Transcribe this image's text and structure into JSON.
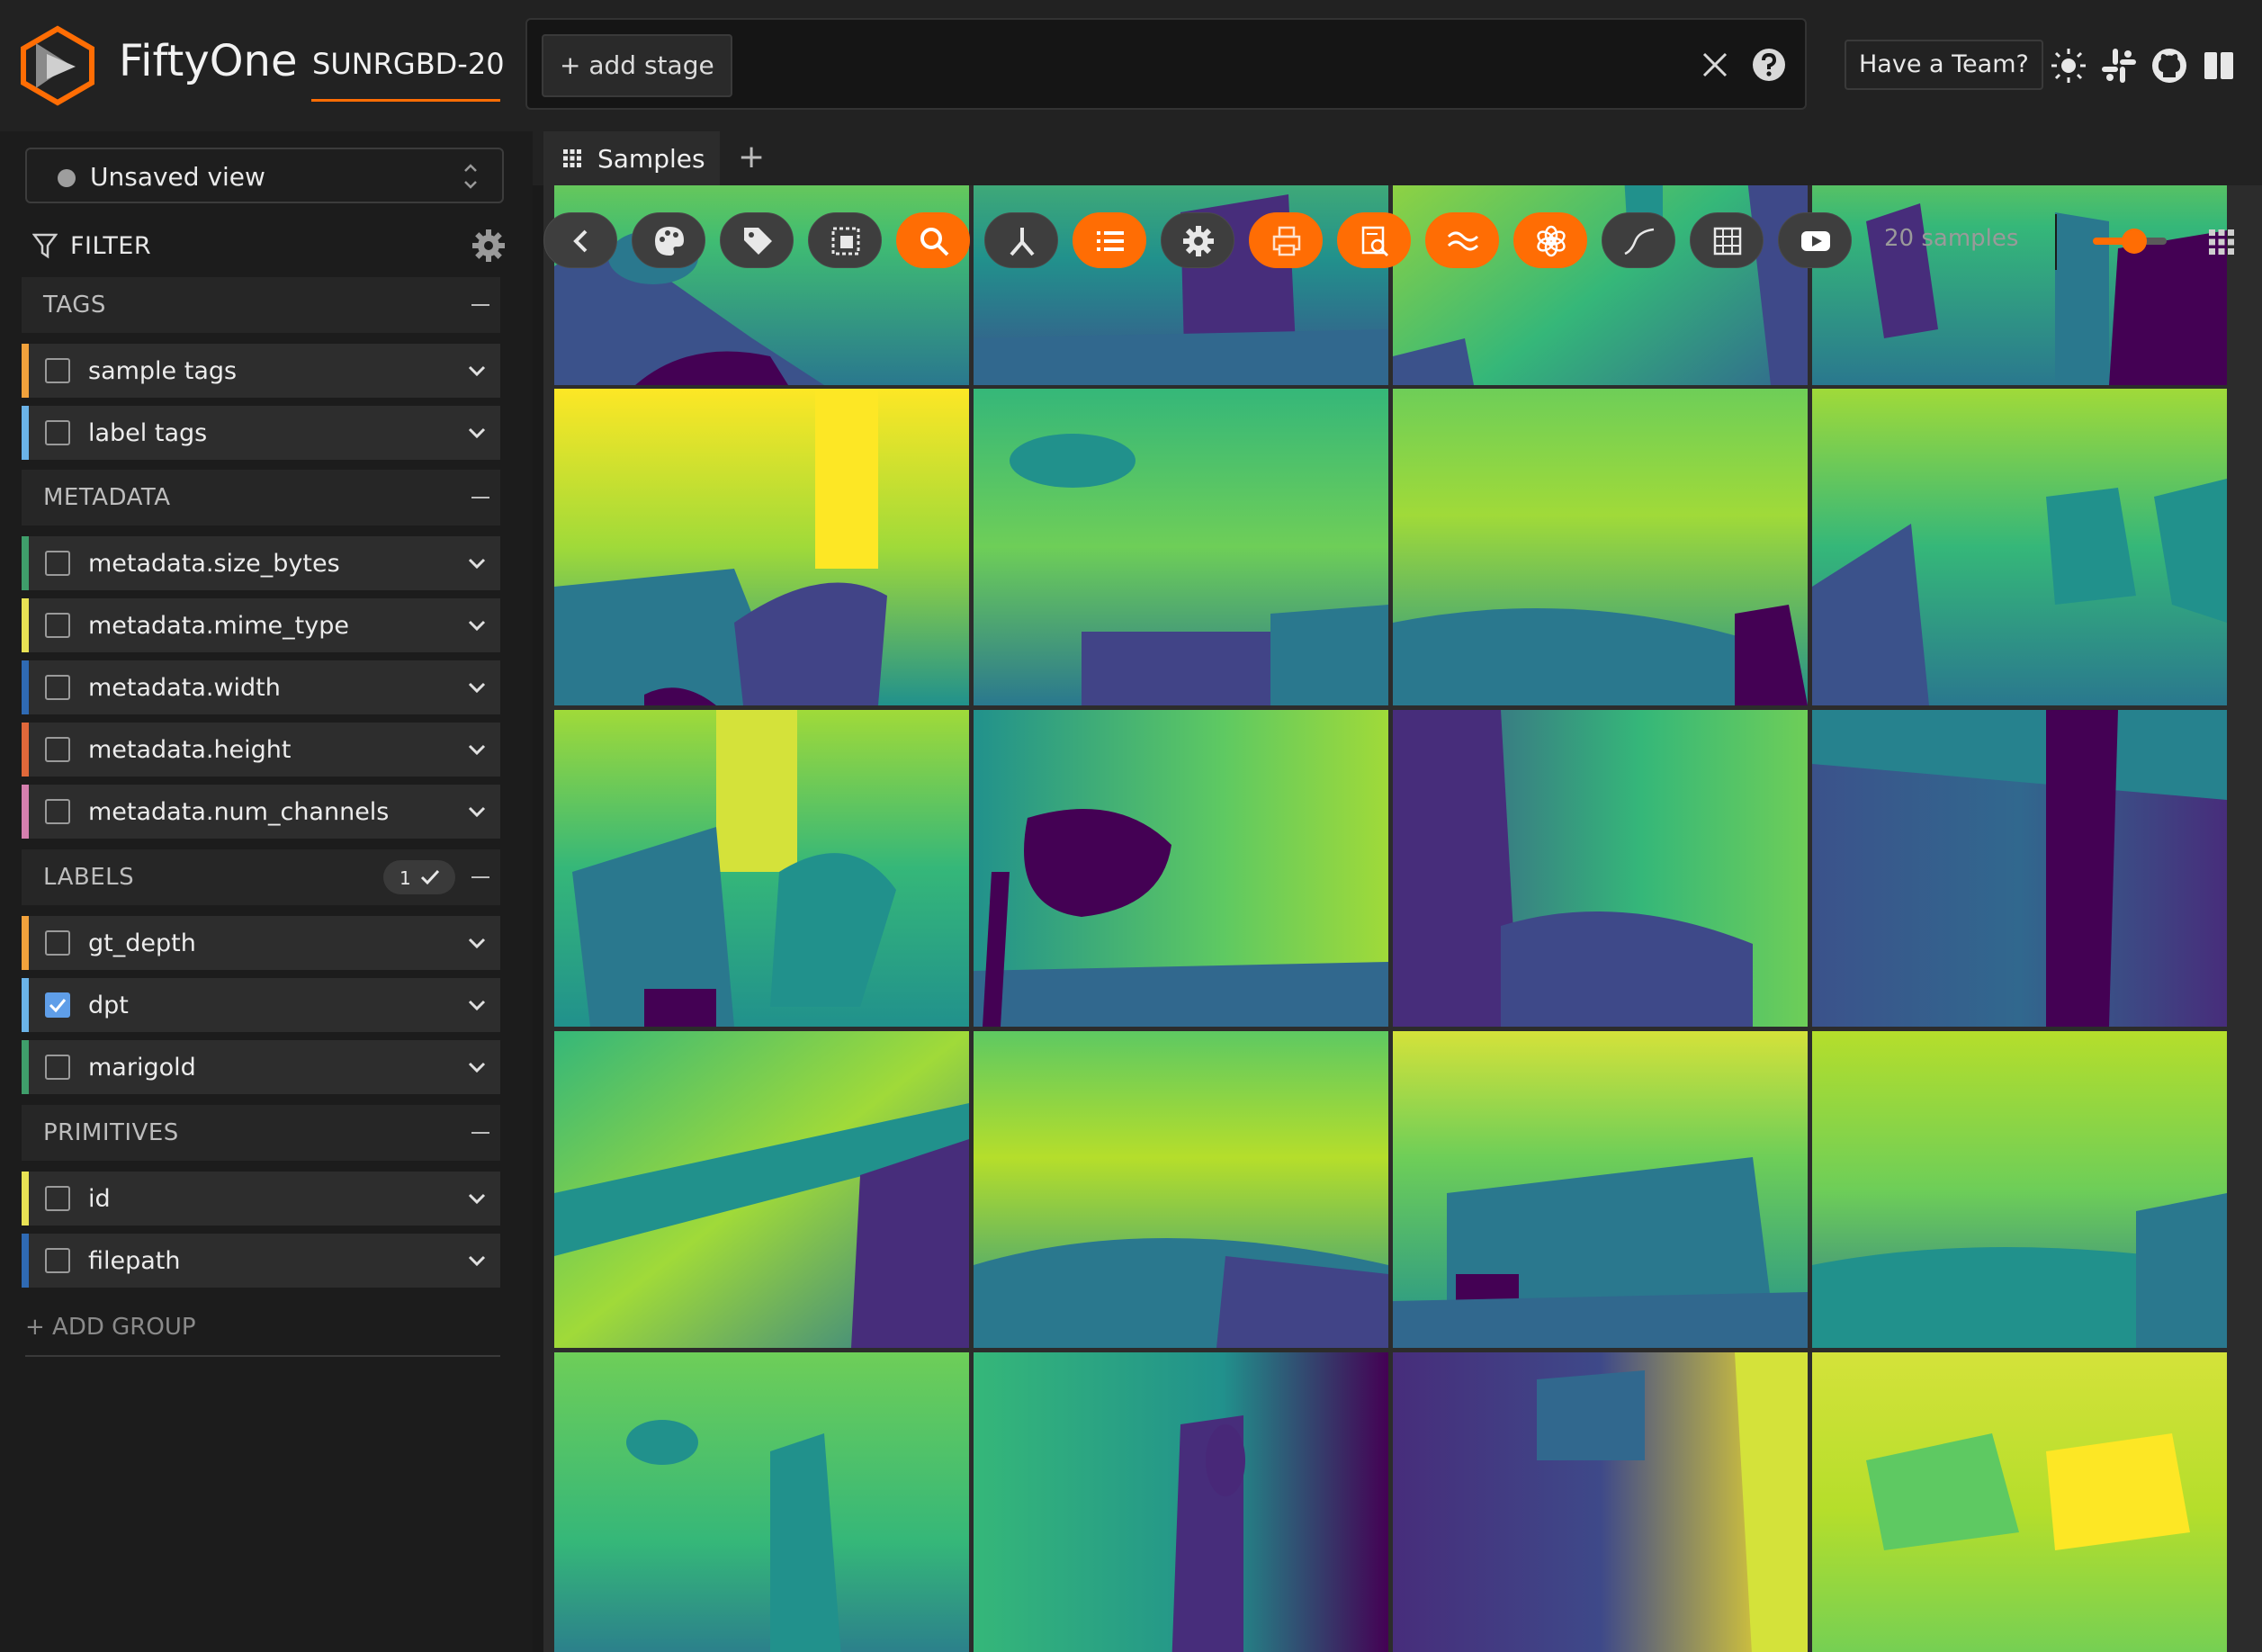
{
  "app": {
    "name": "FiftyOne",
    "dataset": "SUNRGBD-20"
  },
  "viewbar": {
    "add_stage": "+ add stage"
  },
  "header": {
    "team_button": "Have a Team?"
  },
  "sidebar": {
    "view_select": "Unsaved view",
    "filter_label": "FILTER",
    "groups": [
      {
        "title": "TAGS",
        "fields": [
          {
            "label": "sample tags",
            "color": "#f2a23c",
            "checked": false
          },
          {
            "label": "label tags",
            "color": "#6bb3e8",
            "checked": false
          }
        ]
      },
      {
        "title": "METADATA",
        "fields": [
          {
            "label": "metadata.size_bytes",
            "color": "#3f9e6b",
            "checked": false
          },
          {
            "label": "metadata.mime_type",
            "color": "#e9e254",
            "checked": false
          },
          {
            "label": "metadata.width",
            "color": "#2f6ab3",
            "checked": false
          },
          {
            "label": "metadata.height",
            "color": "#e0683a",
            "checked": false
          },
          {
            "label": "metadata.num_channels",
            "color": "#d57fae",
            "checked": false
          }
        ]
      },
      {
        "title": "LABELS",
        "badge": "1",
        "fields": [
          {
            "label": "gt_depth",
            "color": "#f2a23c",
            "checked": false
          },
          {
            "label": "dpt",
            "color": "#6bb3e8",
            "checked": true
          },
          {
            "label": "marigold",
            "color": "#3f9e6b",
            "checked": false
          }
        ]
      },
      {
        "title": "PRIMITIVES",
        "fields": [
          {
            "label": "id",
            "color": "#e9e254",
            "checked": false
          },
          {
            "label": "filepath",
            "color": "#2f6ab3",
            "checked": false
          }
        ]
      }
    ],
    "add_group": "+ ADD GROUP"
  },
  "main": {
    "tab_label": "Samples",
    "tab_add": "+",
    "sample_count": "20 samples",
    "zoom_level": 0.6,
    "actions": [
      {
        "icon": "chevron-left-icon",
        "active": false
      },
      {
        "icon": "palette-icon",
        "active": false
      },
      {
        "icon": "tag-icon",
        "active": false
      },
      {
        "icon": "selection-icon",
        "active": false
      },
      {
        "icon": "search-icon",
        "active": true
      },
      {
        "icon": "merge-icon",
        "active": false
      },
      {
        "icon": "list-icon",
        "active": true
      },
      {
        "icon": "gear-icon",
        "active": false
      },
      {
        "icon": "printer-icon",
        "active": true
      },
      {
        "icon": "document-search-icon",
        "active": true
      },
      {
        "icon": "wave-icon",
        "active": true
      },
      {
        "icon": "openai-icon",
        "active": true
      },
      {
        "icon": "curve-icon",
        "active": false
      },
      {
        "icon": "grid-table-icon",
        "active": false
      },
      {
        "icon": "youtube-icon",
        "active": false
      }
    ]
  },
  "colors": {
    "accent": "#ff6d04",
    "checkbox": "#5f9ee8"
  }
}
